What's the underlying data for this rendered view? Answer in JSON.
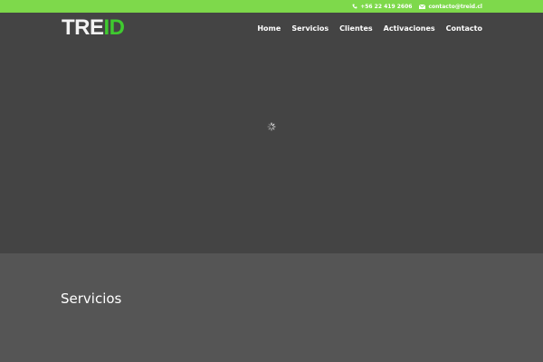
{
  "topbar": {
    "phone": "+56 22 419 2606",
    "email": "contacto@treid.cl",
    "phone_icon": "phone-icon",
    "email_icon": "envelope-icon",
    "background_color": "#7ed94b"
  },
  "header": {
    "logo_part1": "TRE",
    "logo_part2": "ID",
    "logo_colors": {
      "primary": "#f3f3f3",
      "accent": "#3fca2f"
    },
    "nav": [
      {
        "label": "Home"
      },
      {
        "label": "Servicios"
      },
      {
        "label": "Clientes"
      },
      {
        "label": "Activaciones"
      },
      {
        "label": "Contacto"
      }
    ]
  },
  "hero": {
    "loading_icon": "loading-spinner-icon",
    "background_color": "#444444"
  },
  "section": {
    "title": "Servicios",
    "background_color": "#555555"
  }
}
